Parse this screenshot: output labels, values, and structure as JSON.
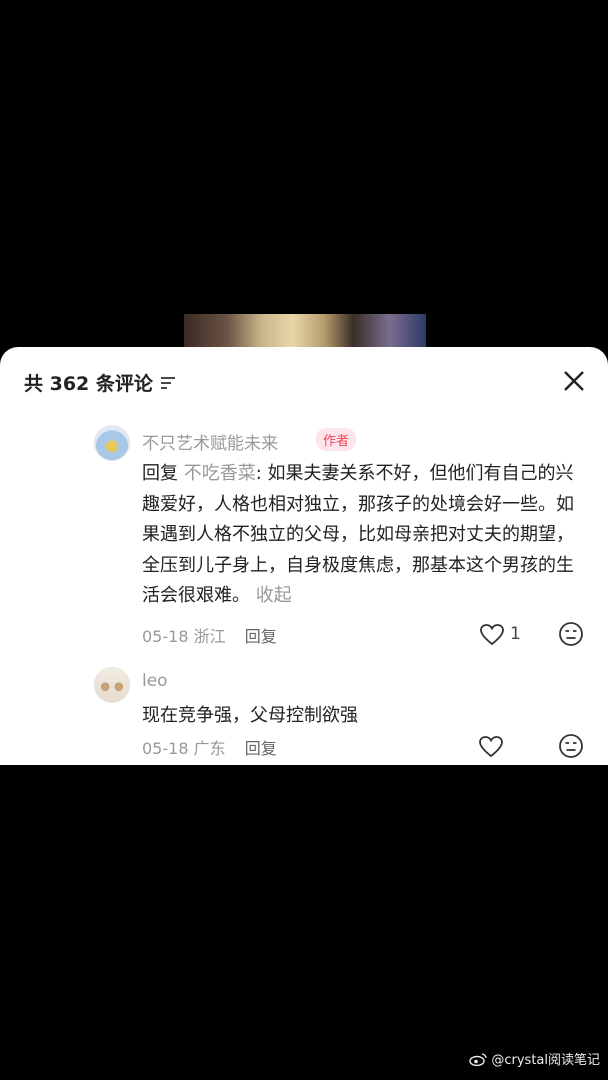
{
  "header": {
    "title": "共 362 条评论",
    "sort_icon": "sort-filter-icon",
    "close_icon": "close-icon"
  },
  "comments": [
    {
      "author": "不只艺术赋能未来",
      "tag": "作者",
      "reply_prefix": "回复 ",
      "reply_target": "不吃香菜",
      "text": ": 如果夫妻关系不好，但他们有自己的兴趣爱好，人格也相对独立，那孩子的处境会好一些。如果遇到人格不独立的父母，比如母亲把对丈夫的期望，全压到儿子身上，自身极度焦虑，那基本这个男孩的生活会很艰难。",
      "collapse": " 收起",
      "date_location": "05-18 浙江",
      "reply_label": "回复",
      "likes": "1"
    },
    {
      "author": "leo",
      "text": "现在竞争强，父母控制欲强",
      "date_location": "05-18 广东",
      "reply_label": "回复"
    }
  ],
  "watermark": {
    "text": "@crystal阅读笔记",
    "icon": "weibo-icon"
  },
  "colors": {
    "tag_bg": "#fde6ea",
    "tag_fg": "#f0445b",
    "muted": "#999999"
  }
}
